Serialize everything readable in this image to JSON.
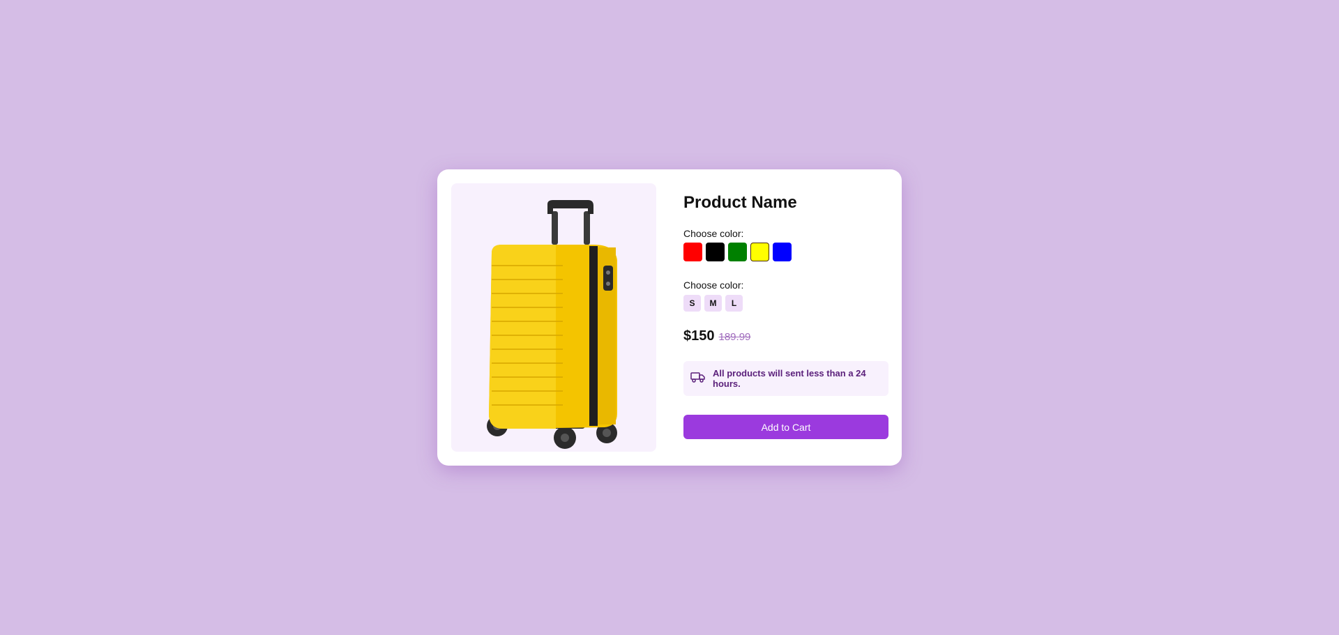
{
  "product": {
    "title": "Product Name",
    "image_alt": "yellow suitcase"
  },
  "color_picker": {
    "label": "Choose color:",
    "options": [
      {
        "color": "#ff0000",
        "selected": false
      },
      {
        "color": "#000000",
        "selected": false
      },
      {
        "color": "#008000",
        "selected": false
      },
      {
        "color": "#ffff00",
        "selected": true
      },
      {
        "color": "#0000ff",
        "selected": false
      }
    ]
  },
  "size_picker": {
    "label": "Choose color:",
    "options": [
      "S",
      "M",
      "L"
    ]
  },
  "pricing": {
    "price": "$150",
    "old_price": "189.99"
  },
  "shipping_notice": {
    "icon": "truck-icon",
    "text": "All products will sent less than a 24 hours."
  },
  "cart": {
    "button_label": "Add to Cart"
  },
  "colors": {
    "background": "#d5bde6",
    "accent": "#9b3ade",
    "notice_text": "#5a1f7a",
    "old_price": "#a06cbd"
  }
}
